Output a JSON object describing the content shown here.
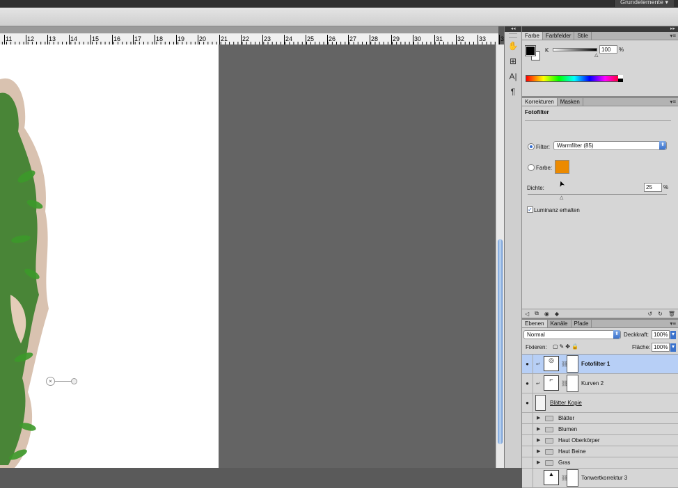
{
  "app": {
    "workspace_label": "Grundelemente ▾"
  },
  "ruler": {
    "labels": [
      "11",
      "12",
      "13",
      "14",
      "15",
      "16",
      "17",
      "18",
      "19",
      "20",
      "21",
      "22",
      "23",
      "24",
      "25",
      "26",
      "27",
      "28",
      "29",
      "30",
      "31",
      "32",
      "33",
      "34"
    ]
  },
  "icons": {
    "close_pin": "×",
    "panel_collapse": "◂◂",
    "panel_expand": "▸▸",
    "panel_menu": "▾≡",
    "text_tool": "A|",
    "paragraph_tool": "¶",
    "tool_a": "✋",
    "tool_b": "⊞",
    "radio_arrow": "⬍",
    "eye": "●",
    "triangle": "▶",
    "chain": "⛓",
    "checkmark": "✓",
    "cursor": "➤"
  },
  "color_panel": {
    "tabs": [
      "Farbe",
      "Farbfelder",
      "Stile"
    ],
    "channel_label": "K",
    "value": "100",
    "unit": "%",
    "foreground_color": "#000000",
    "background_color": "#ffffff"
  },
  "adjustments_panel": {
    "tabs": [
      "Korrekturen",
      "Masken"
    ],
    "title": "Fotofilter",
    "filter_label": "Filter:",
    "filter_value": "Warmfilter (85)",
    "color_label": "Farbe:",
    "color_value": "#ec8a00",
    "density_label": "Dichte:",
    "density_value": "25",
    "density_unit": "%",
    "density_fraction": 0.25,
    "luminance_label": "Luminanz erhalten",
    "luminance_checked": true,
    "selected_option": "filter"
  },
  "layers_panel": {
    "tabs": [
      "Ebenen",
      "Kanäle",
      "Pfade"
    ],
    "blend_mode": "Normal",
    "opacity_label": "Deckkraft:",
    "opacity_value": "100%",
    "lock_label": "Fixieren:",
    "fill_label": "Fläche:",
    "fill_value": "100%",
    "layers": [
      {
        "name": "Fotofilter 1",
        "type": "adjustment",
        "selected": true,
        "visible": true
      },
      {
        "name": "Kurven 2",
        "type": "adjustment",
        "selected": false,
        "visible": true
      },
      {
        "name": "Blätter Kopie",
        "type": "pixel",
        "selected": false,
        "visible": true
      },
      {
        "name": "Blätter",
        "type": "group",
        "selected": false,
        "visible": false
      },
      {
        "name": "Blumen",
        "type": "group",
        "selected": false,
        "visible": false
      },
      {
        "name": "Haut Oberkörper",
        "type": "group",
        "selected": false,
        "visible": false
      },
      {
        "name": "Haut Beine",
        "type": "group",
        "selected": false,
        "visible": false
      },
      {
        "name": "Gras",
        "type": "group",
        "selected": false,
        "visible": false
      },
      {
        "name": "Tonwertkorrektur 3",
        "type": "adjustment",
        "selected": false,
        "visible": false
      }
    ]
  }
}
